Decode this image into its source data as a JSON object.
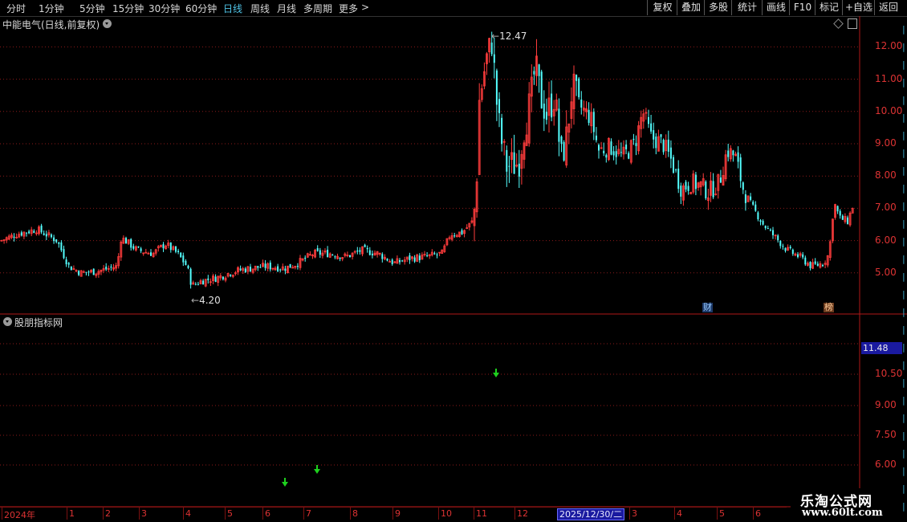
{
  "toolbar": {
    "periods": [
      {
        "label": "分时",
        "x": 8
      },
      {
        "label": "1分钟",
        "x": 48
      },
      {
        "label": "5分钟",
        "x": 99
      },
      {
        "label": "15分钟",
        "x": 140
      },
      {
        "label": "30分钟",
        "x": 185
      },
      {
        "label": "60分钟",
        "x": 231
      },
      {
        "label": "日线",
        "x": 278,
        "active": true
      },
      {
        "label": "周线",
        "x": 312
      },
      {
        "label": "月线",
        "x": 345
      },
      {
        "label": "多周期",
        "x": 378
      },
      {
        "label": "更多",
        "x": 422
      }
    ],
    "more_arrow": ">",
    "buttons": [
      "复权",
      "叠加",
      "多股",
      "统计",
      "画线",
      "F10",
      "标记",
      "+自选",
      "返回"
    ]
  },
  "main_chart": {
    "title": "中能电气(日线,前复权)",
    "price_labels": [
      "12.00",
      "11.00",
      "10.00",
      "9.00",
      "8.00",
      "7.00",
      "6.00",
      "5.00"
    ],
    "high_annotation": "12.47",
    "low_annotation": "4.20",
    "flag_fin": "财",
    "flag_list": "榜"
  },
  "indicator": {
    "title": "股朋指标网",
    "cursor_value": "11.48",
    "labels": [
      "10.50",
      "9.00",
      "7.50",
      "6.00"
    ]
  },
  "time_axis": {
    "months": [
      "2024年",
      "1",
      "2",
      "3",
      "4",
      "5",
      "6",
      "7",
      "8",
      "9",
      "10",
      "11",
      "12",
      "3",
      "4",
      "5",
      "6"
    ],
    "cursor_date": "2025/12/30/二"
  },
  "watermark": {
    "line1": "乐淘公式网",
    "line2": "www.60lt.com"
  },
  "colors": {
    "up": "#ff3c3c",
    "down": "#54ffff",
    "grid": "#8b1a1a",
    "signal": "#1ed01e"
  },
  "chart_data": {
    "type": "candlestick",
    "ylim": [
      4.0,
      12.5
    ],
    "close_path": [
      [
        0,
        6.0
      ],
      [
        20,
        6.2
      ],
      [
        45,
        6.35
      ],
      [
        70,
        6.0
      ],
      [
        85,
        5.2
      ],
      [
        100,
        5.0
      ],
      [
        120,
        5.05
      ],
      [
        145,
        5.2
      ],
      [
        150,
        6.1
      ],
      [
        170,
        5.7
      ],
      [
        190,
        5.6
      ],
      [
        205,
        5.9
      ],
      [
        220,
        5.6
      ],
      [
        232,
        5.2
      ],
      [
        238,
        4.6
      ],
      [
        250,
        4.75
      ],
      [
        270,
        4.85
      ],
      [
        285,
        5.0
      ],
      [
        300,
        5.1
      ],
      [
        330,
        5.2
      ],
      [
        355,
        5.15
      ],
      [
        370,
        5.3
      ],
      [
        390,
        5.6
      ],
      [
        410,
        5.6
      ],
      [
        430,
        5.5
      ],
      [
        450,
        5.7
      ],
      [
        470,
        5.6
      ],
      [
        490,
        5.3
      ],
      [
        510,
        5.45
      ],
      [
        530,
        5.5
      ],
      [
        550,
        5.6
      ],
      [
        560,
        6.2
      ],
      [
        575,
        6.25
      ],
      [
        588,
        6.6
      ],
      [
        592,
        7.3
      ],
      [
        596,
        10.3
      ],
      [
        604,
        11.5
      ],
      [
        612,
        12.2
      ],
      [
        617,
        10.5
      ],
      [
        622,
        9.3
      ],
      [
        630,
        8.3
      ],
      [
        645,
        8.4
      ],
      [
        652,
        9.5
      ],
      [
        660,
        10.3
      ],
      [
        666,
        11.4
      ],
      [
        672,
        10.5
      ],
      [
        680,
        9.9
      ],
      [
        690,
        10.5
      ],
      [
        698,
        8.5
      ],
      [
        705,
        9.2
      ],
      [
        712,
        10.8
      ],
      [
        720,
        10.2
      ],
      [
        735,
        9.8
      ],
      [
        745,
        8.8
      ],
      [
        760,
        8.9
      ],
      [
        775,
        8.6
      ],
      [
        790,
        9.0
      ],
      [
        800,
        10.0
      ],
      [
        810,
        9.2
      ],
      [
        825,
        9.0
      ],
      [
        835,
        8.5
      ],
      [
        848,
        7.6
      ],
      [
        860,
        7.8
      ],
      [
        872,
        7.7
      ],
      [
        882,
        7.5
      ],
      [
        895,
        7.8
      ],
      [
        905,
        8.8
      ],
      [
        915,
        8.6
      ],
      [
        925,
        7.6
      ],
      [
        935,
        7.1
      ],
      [
        950,
        6.5
      ],
      [
        965,
        6.1
      ],
      [
        980,
        5.7
      ],
      [
        995,
        5.5
      ],
      [
        1010,
        5.2
      ],
      [
        1025,
        5.3
      ],
      [
        1032,
        5.6
      ],
      [
        1038,
        7.2
      ],
      [
        1045,
        6.7
      ],
      [
        1055,
        6.6
      ],
      [
        1062,
        7.1
      ]
    ],
    "signals": [
      355,
      395,
      618
    ]
  }
}
